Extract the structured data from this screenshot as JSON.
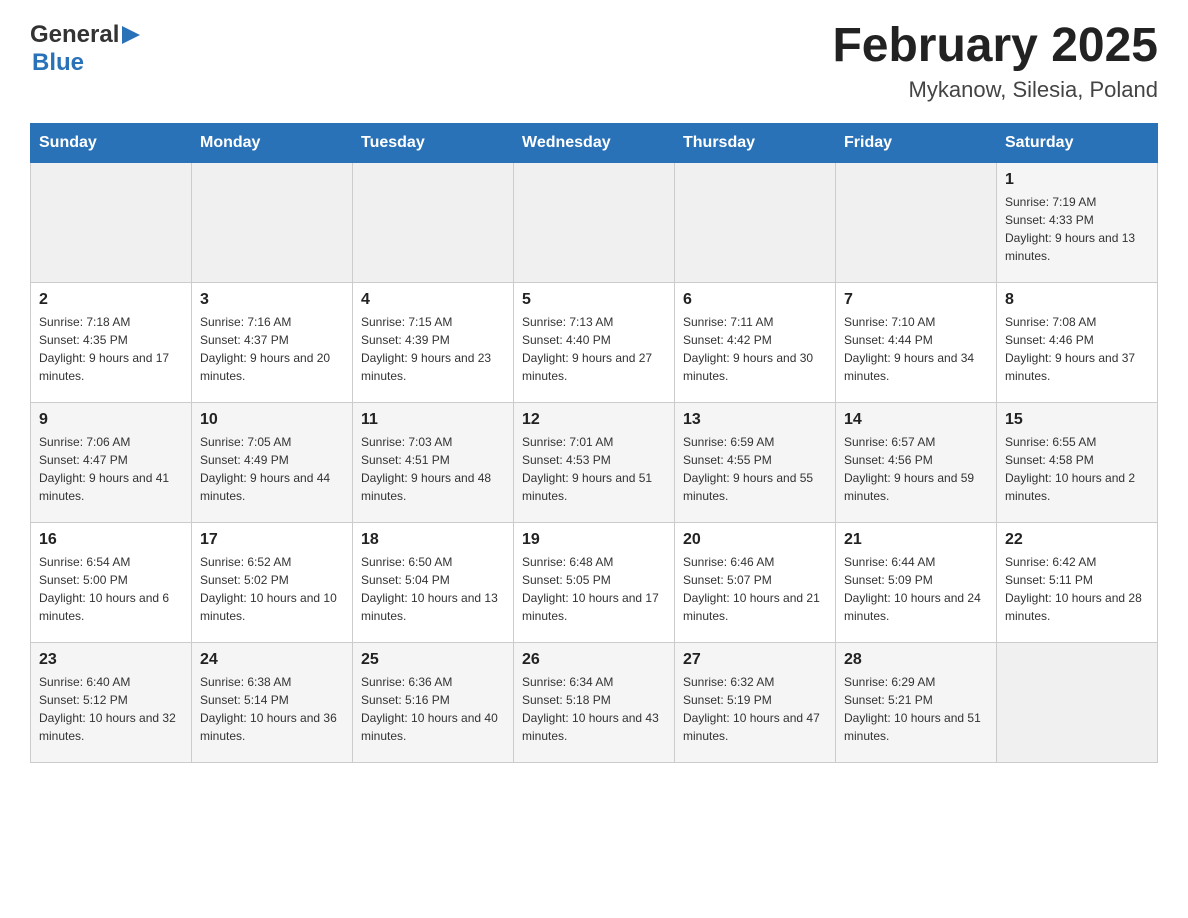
{
  "header": {
    "logo_general": "General",
    "logo_blue": "Blue",
    "month_title": "February 2025",
    "location": "Mykanow, Silesia, Poland"
  },
  "weekdays": [
    "Sunday",
    "Monday",
    "Tuesday",
    "Wednesday",
    "Thursday",
    "Friday",
    "Saturday"
  ],
  "weeks": [
    {
      "days": [
        {
          "number": "",
          "info": ""
        },
        {
          "number": "",
          "info": ""
        },
        {
          "number": "",
          "info": ""
        },
        {
          "number": "",
          "info": ""
        },
        {
          "number": "",
          "info": ""
        },
        {
          "number": "",
          "info": ""
        },
        {
          "number": "1",
          "info": "Sunrise: 7:19 AM\nSunset: 4:33 PM\nDaylight: 9 hours and 13 minutes."
        }
      ]
    },
    {
      "days": [
        {
          "number": "2",
          "info": "Sunrise: 7:18 AM\nSunset: 4:35 PM\nDaylight: 9 hours and 17 minutes."
        },
        {
          "number": "3",
          "info": "Sunrise: 7:16 AM\nSunset: 4:37 PM\nDaylight: 9 hours and 20 minutes."
        },
        {
          "number": "4",
          "info": "Sunrise: 7:15 AM\nSunset: 4:39 PM\nDaylight: 9 hours and 23 minutes."
        },
        {
          "number": "5",
          "info": "Sunrise: 7:13 AM\nSunset: 4:40 PM\nDaylight: 9 hours and 27 minutes."
        },
        {
          "number": "6",
          "info": "Sunrise: 7:11 AM\nSunset: 4:42 PM\nDaylight: 9 hours and 30 minutes."
        },
        {
          "number": "7",
          "info": "Sunrise: 7:10 AM\nSunset: 4:44 PM\nDaylight: 9 hours and 34 minutes."
        },
        {
          "number": "8",
          "info": "Sunrise: 7:08 AM\nSunset: 4:46 PM\nDaylight: 9 hours and 37 minutes."
        }
      ]
    },
    {
      "days": [
        {
          "number": "9",
          "info": "Sunrise: 7:06 AM\nSunset: 4:47 PM\nDaylight: 9 hours and 41 minutes."
        },
        {
          "number": "10",
          "info": "Sunrise: 7:05 AM\nSunset: 4:49 PM\nDaylight: 9 hours and 44 minutes."
        },
        {
          "number": "11",
          "info": "Sunrise: 7:03 AM\nSunset: 4:51 PM\nDaylight: 9 hours and 48 minutes."
        },
        {
          "number": "12",
          "info": "Sunrise: 7:01 AM\nSunset: 4:53 PM\nDaylight: 9 hours and 51 minutes."
        },
        {
          "number": "13",
          "info": "Sunrise: 6:59 AM\nSunset: 4:55 PM\nDaylight: 9 hours and 55 minutes."
        },
        {
          "number": "14",
          "info": "Sunrise: 6:57 AM\nSunset: 4:56 PM\nDaylight: 9 hours and 59 minutes."
        },
        {
          "number": "15",
          "info": "Sunrise: 6:55 AM\nSunset: 4:58 PM\nDaylight: 10 hours and 2 minutes."
        }
      ]
    },
    {
      "days": [
        {
          "number": "16",
          "info": "Sunrise: 6:54 AM\nSunset: 5:00 PM\nDaylight: 10 hours and 6 minutes."
        },
        {
          "number": "17",
          "info": "Sunrise: 6:52 AM\nSunset: 5:02 PM\nDaylight: 10 hours and 10 minutes."
        },
        {
          "number": "18",
          "info": "Sunrise: 6:50 AM\nSunset: 5:04 PM\nDaylight: 10 hours and 13 minutes."
        },
        {
          "number": "19",
          "info": "Sunrise: 6:48 AM\nSunset: 5:05 PM\nDaylight: 10 hours and 17 minutes."
        },
        {
          "number": "20",
          "info": "Sunrise: 6:46 AM\nSunset: 5:07 PM\nDaylight: 10 hours and 21 minutes."
        },
        {
          "number": "21",
          "info": "Sunrise: 6:44 AM\nSunset: 5:09 PM\nDaylight: 10 hours and 24 minutes."
        },
        {
          "number": "22",
          "info": "Sunrise: 6:42 AM\nSunset: 5:11 PM\nDaylight: 10 hours and 28 minutes."
        }
      ]
    },
    {
      "days": [
        {
          "number": "23",
          "info": "Sunrise: 6:40 AM\nSunset: 5:12 PM\nDaylight: 10 hours and 32 minutes."
        },
        {
          "number": "24",
          "info": "Sunrise: 6:38 AM\nSunset: 5:14 PM\nDaylight: 10 hours and 36 minutes."
        },
        {
          "number": "25",
          "info": "Sunrise: 6:36 AM\nSunset: 5:16 PM\nDaylight: 10 hours and 40 minutes."
        },
        {
          "number": "26",
          "info": "Sunrise: 6:34 AM\nSunset: 5:18 PM\nDaylight: 10 hours and 43 minutes."
        },
        {
          "number": "27",
          "info": "Sunrise: 6:32 AM\nSunset: 5:19 PM\nDaylight: 10 hours and 47 minutes."
        },
        {
          "number": "28",
          "info": "Sunrise: 6:29 AM\nSunset: 5:21 PM\nDaylight: 10 hours and 51 minutes."
        },
        {
          "number": "",
          "info": ""
        }
      ]
    }
  ]
}
